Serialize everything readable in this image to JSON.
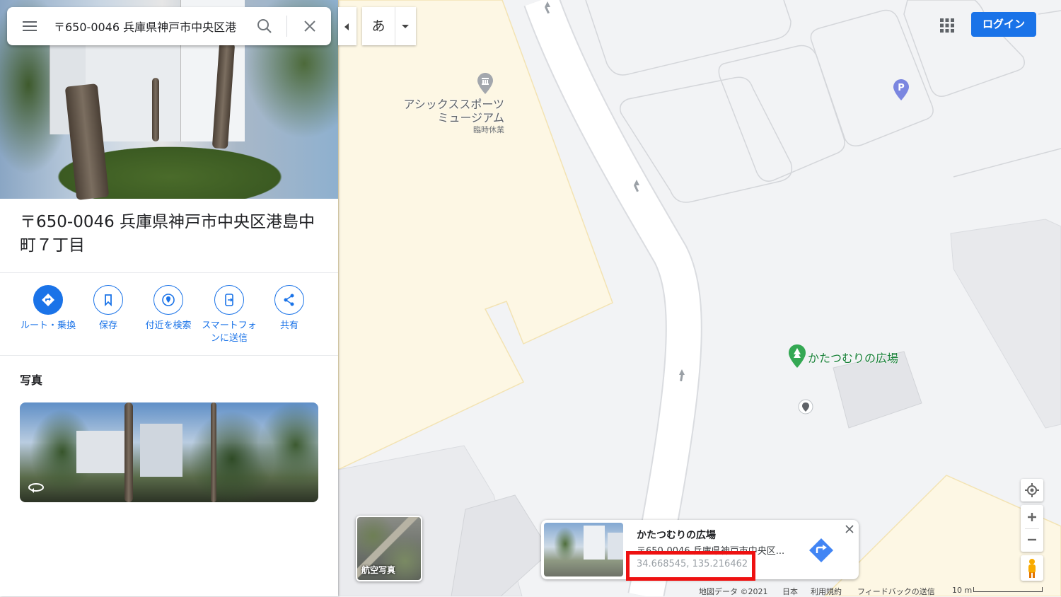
{
  "search": {
    "value": "〒650-0046 兵庫県神戸市中央区港"
  },
  "place": {
    "title": "〒650-0046 兵庫県神戸市中央区港島中町７丁目"
  },
  "actions": [
    {
      "label": "ルート・乗換",
      "icon": "directions-icon"
    },
    {
      "label": "保存",
      "icon": "bookmark-icon"
    },
    {
      "label": "付近を検索",
      "icon": "nearby-icon"
    },
    {
      "label": "スマートフォンに送信",
      "icon": "phone-send-icon"
    },
    {
      "label": "共有",
      "icon": "share-icon"
    }
  ],
  "photos": {
    "heading": "写真"
  },
  "map": {
    "ime_char": "あ",
    "login": "ログイン",
    "poi_museum": {
      "name_line1": "アシックススポーツ",
      "name_line2": "ミュージアム",
      "status": "臨時休業"
    },
    "poi_park": "かたつむりの広場",
    "aerial_label": "航空写真"
  },
  "info_card": {
    "title": "かたつむりの広場",
    "address": "〒650-0046 兵庫県神戸市中央区...",
    "coords": "34.668545, 135.216462"
  },
  "footer": {
    "map_data": "地図データ ©2021",
    "country": "日本",
    "terms": "利用規約",
    "feedback": "フィードバックの送信",
    "scale": "10 m"
  },
  "colors": {
    "accent": "#1a73e8",
    "park": "#188038",
    "highlight": "#ee1111"
  }
}
